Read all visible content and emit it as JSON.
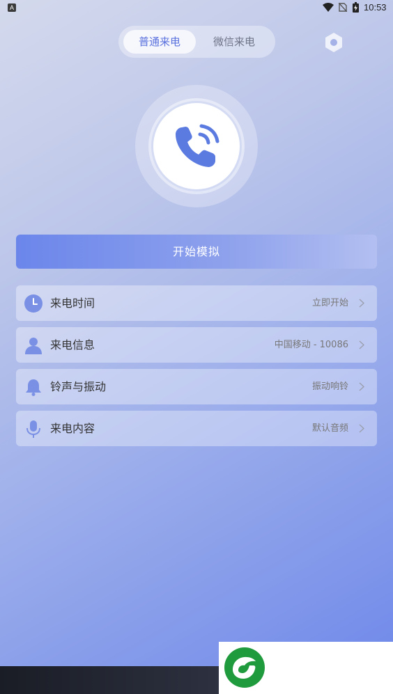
{
  "status_bar": {
    "time": "10:53",
    "icons": [
      "app-notification-icon",
      "wifi-icon",
      "no-sim-icon",
      "battery-icon"
    ]
  },
  "tabs": {
    "active": "普通来电",
    "inactive": "微信来电"
  },
  "start_button": "开始模拟",
  "settings": [
    {
      "label": "来电时间",
      "value": "立即开始",
      "icon": "clock-icon"
    },
    {
      "label": "来电信息",
      "value": "中国移动 - 10086",
      "icon": "person-icon"
    },
    {
      "label": "铃声与振动",
      "value": "振动响铃",
      "icon": "bell-icon"
    },
    {
      "label": "来电内容",
      "value": "默认音频",
      "icon": "microphone-icon"
    }
  ],
  "colors": {
    "accent": "#5b72de",
    "icon_fill": "#7a90e4",
    "logo_green": "#1f9a3c"
  }
}
